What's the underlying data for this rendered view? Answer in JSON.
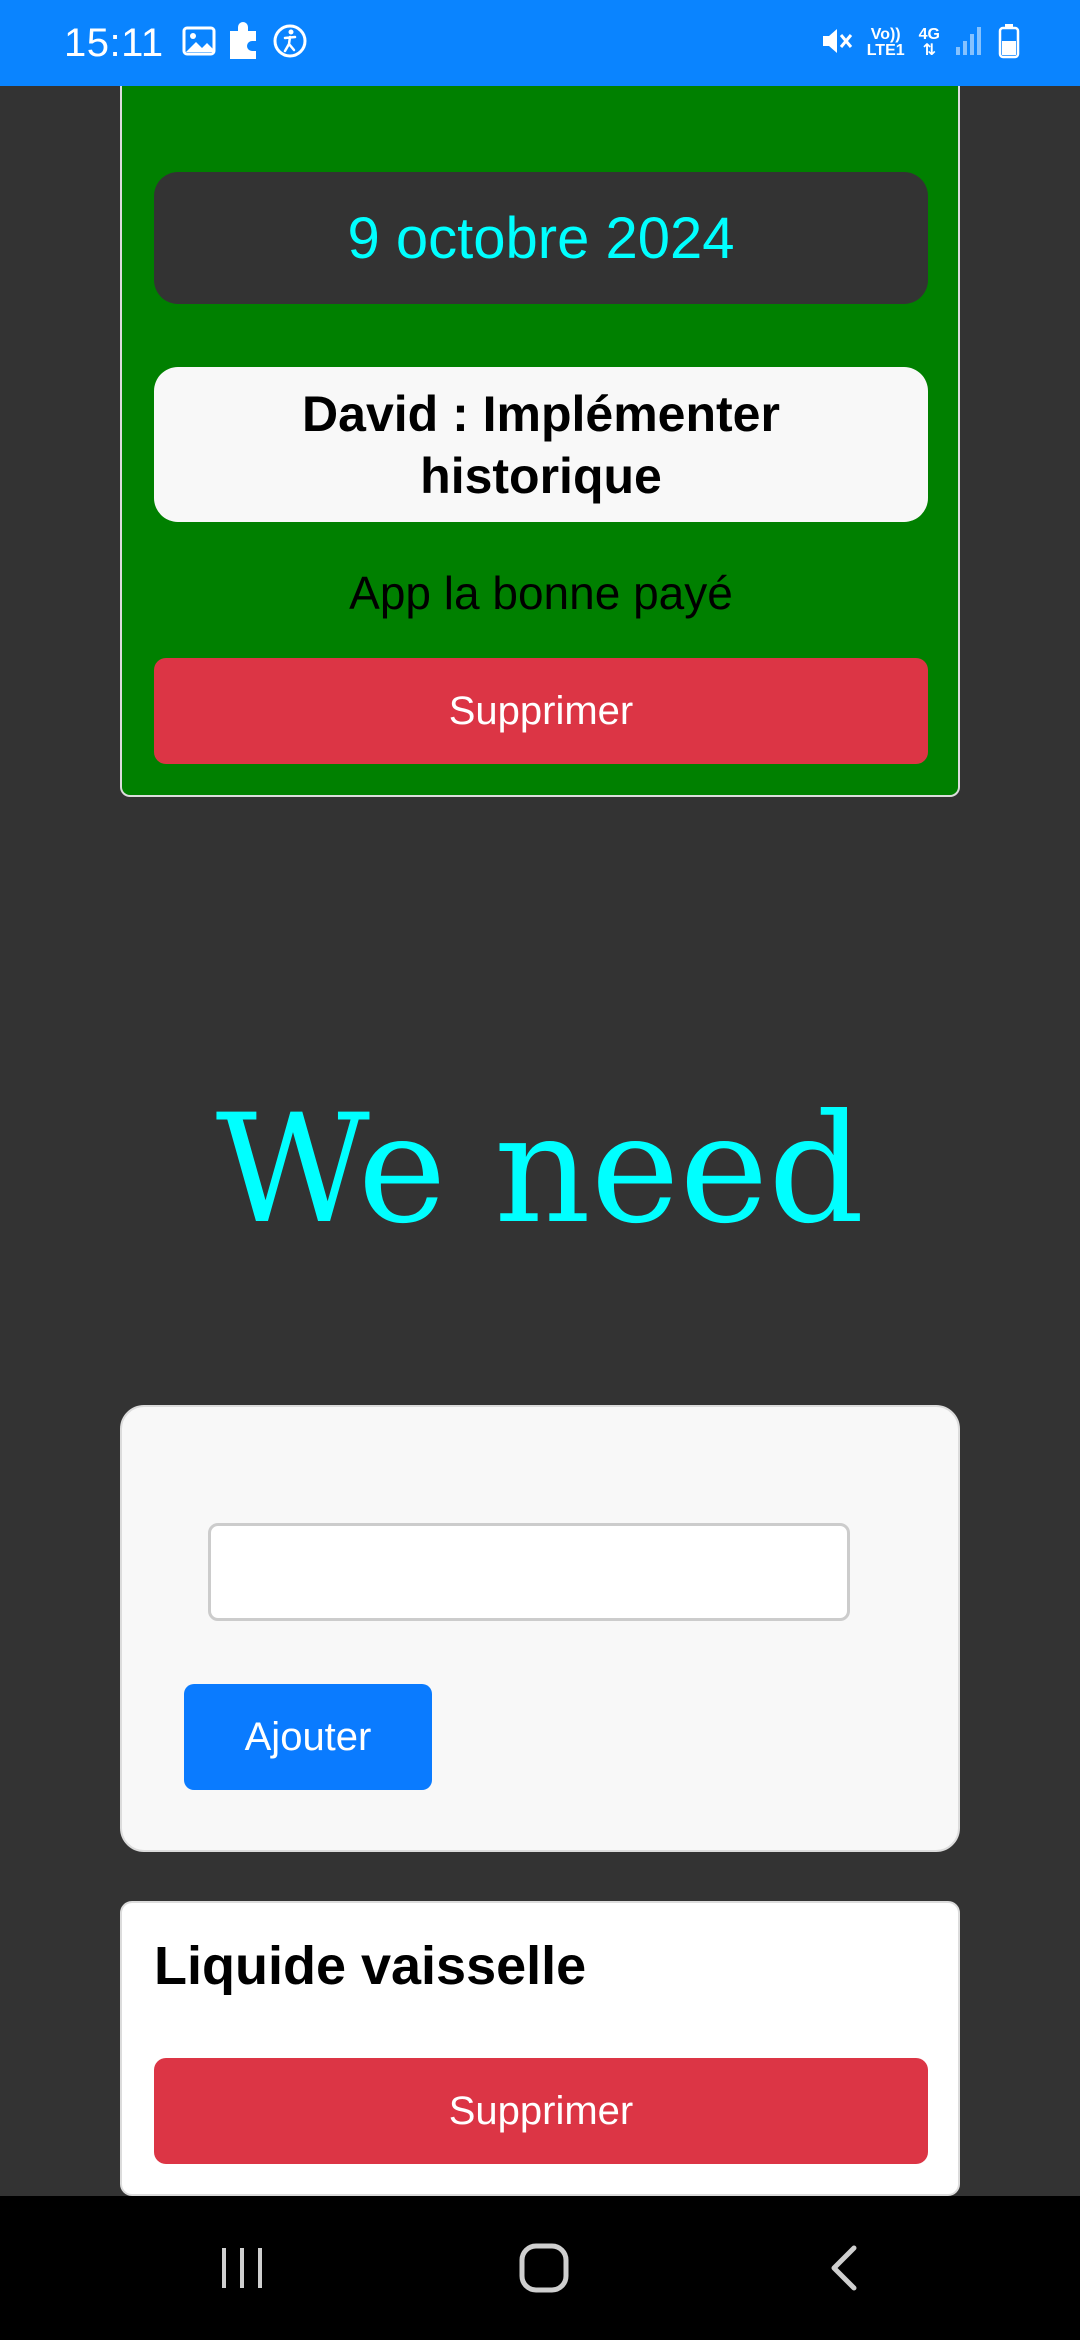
{
  "status_bar": {
    "time": "15:11",
    "network_top": "Vo))",
    "network_bottom": "LTE1",
    "network_type": "4G",
    "icons": [
      "image-icon",
      "puzzle-icon",
      "accessibility-icon",
      "mute-icon",
      "signal-icon",
      "battery-icon"
    ]
  },
  "event_card": {
    "date": "9 octobre 2024",
    "task_title": "David : Implémenter historique",
    "task_description": "App la bonne payé",
    "delete_label": "Supprimer",
    "background_color": "#008000"
  },
  "section": {
    "heading": "We need"
  },
  "add_form": {
    "input_value": "",
    "input_placeholder": "",
    "add_label": "Ajouter"
  },
  "items": [
    {
      "title": "Liquide vaisselle",
      "delete_label": "Supprimer"
    }
  ],
  "colors": {
    "status_bar": "#0a84ff",
    "page_background": "#333333",
    "accent_cyan": "#00ffff",
    "danger": "#dc3545",
    "primary": "#0a7bff"
  }
}
